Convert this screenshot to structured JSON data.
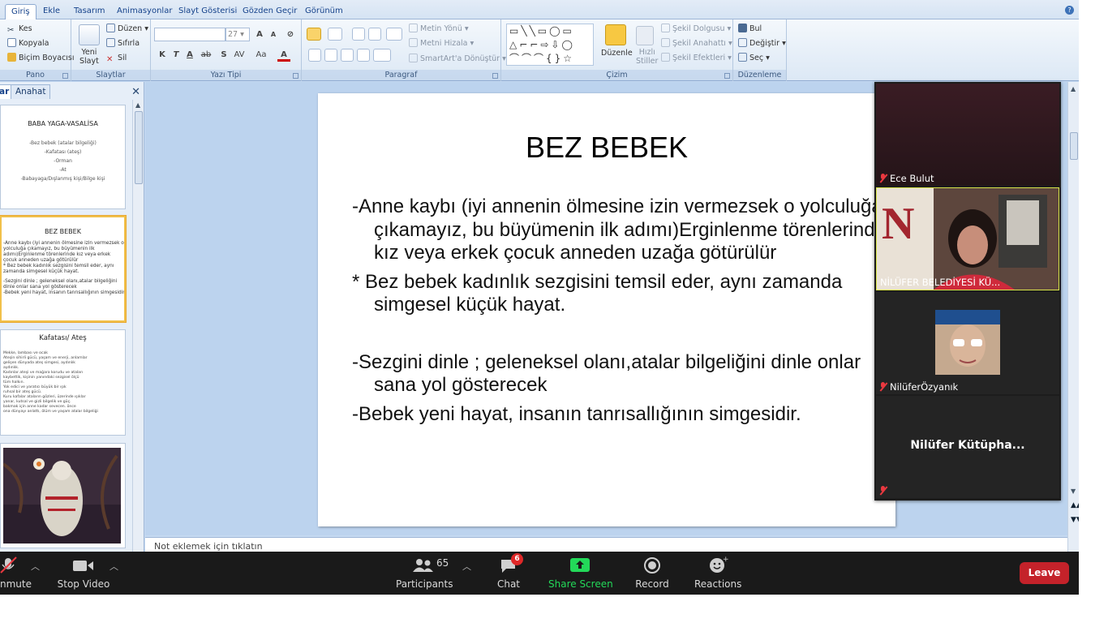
{
  "ribbon_tabs": [
    "Giriş",
    "Ekle",
    "Tasarım",
    "Animasyonlar",
    "Slayt Gösterisi",
    "Gözden Geçir",
    "Görünüm"
  ],
  "ribbon": {
    "pano": {
      "label": "Pano",
      "cut": "Kes",
      "copy": "Kopyala",
      "format_painter": "Biçim Boyacısı"
    },
    "slaytlar": {
      "label": "Slaytlar",
      "new_slide_1": "Yeni",
      "new_slide_2": "Slayt",
      "layout": "Düzen",
      "reset": "Sıfırla",
      "delete": "Sil"
    },
    "yazi_tipi": {
      "label": "Yazı Tipi",
      "font_size": "27"
    },
    "paragraf": {
      "label": "Paragraf",
      "text_direction": "Metin Yönü",
      "align_text": "Metni Hizala",
      "smartart": "SmartArt'a Dönüştür"
    },
    "cizim": {
      "label": "Çizim",
      "arrange": "Düzenle",
      "quick_styles_1": "Hızlı",
      "quick_styles_2": "Stiller",
      "shape_fill": "Şekil Dolgusu",
      "shape_outline": "Şekil Anahattı",
      "shape_effects": "Şekil Efektleri"
    },
    "duzenleme": {
      "label": "Düzenleme",
      "find": "Bul",
      "replace": "Değiştir",
      "select": "Seç"
    }
  },
  "panel_tabs": {
    "slides": "ar",
    "outline": "Anahat"
  },
  "thumbnails": [
    {
      "title": "BABA YAGA-VASALİSA",
      "lines": [
        "-Bez bebek (atalar bilgeliği)",
        "-Kafatası (ateş)",
        "-Orman",
        "-At",
        "-Babayaga/Dışlanmış kişi/Bilge kişi"
      ]
    },
    {
      "title": "BEZ BEBEK",
      "lines": [
        "-Anne kaybı (iyi annenin ölmesine izin vermezsek o",
        "  yolculuğa çıkamayız, bu büyümenin ilk",
        "  adımı)Erginlenme törenlerinde kız veya erkek",
        "  çocuk anneden uzağa götürülür",
        "* Bez bebek kadınlık sezgisini temsil eder, aynı",
        "  zamanda simgesel küçük hayat.",
        "",
        "-Sezgini dinle ; geleneksel olanı,atalar bilgeliğini",
        "  dinle onlar sana yol gösterecek",
        "-Bebek yeni hayat, insanın tanrısallığının simgesidir."
      ]
    },
    {
      "title": "Kafatası/ Ateş",
      "lines": [
        "Mekke, lambası ve ocak",
        "Ateşin sihirli gücü, yaşam ve enerji, anlamlar",
        "gelişen dünyada ateş simgesi, aydınlık",
        "aydınlık.",
        "Kadınlar ateşi ve mağara korudu ve ataları",
        "kaybettik, kişinin yanındaki sezgisel ölçü",
        "tüm halkın.",
        "Yok edici ve yaratıcı büyük bir ışık",
        "ruhsal bir ateş gücü.",
        "Kuru kafalar ataların gözleri, üzerinde ışıklar",
        "yanar, kutsal ve gizli bilgelik ve güç.",
        "bakmak için anne kadar sevecen. önce",
        "ona dünyayı anlattı, ölüm ve yaşam atalar bilgeliği"
      ]
    },
    {
      "title": "",
      "lines": []
    }
  ],
  "slide": {
    "title": "BEZ BEBEK",
    "paragraphs": [
      "-Anne kaybı (iyi annenin ölmesine izin vermezsek o yolculuğa çıkamayız, bu büyümenin ilk adımı)Erginlenme törenlerinde kız veya erkek çocuk anneden uzağa götürülür",
      "* Bez bebek kadınlık sezgisini temsil eder, aynı zamanda simgesel küçük hayat.",
      "-Sezgini dinle ; geleneksel olanı,atalar bilgeliğini dinle onlar sana yol gösterecek",
      "-Bebek yeni hayat, insanın tanrısallığının simgesidir."
    ]
  },
  "notes_placeholder": "Not eklemek için tıklatın",
  "participants": [
    {
      "name": "Ece Bulut",
      "muted": true
    },
    {
      "name": "NİLÜFER BELEDİYESİ KÜ...",
      "muted": false,
      "active_speaker": true
    },
    {
      "name": "NilüferÖzyanık",
      "muted": true
    },
    {
      "name": "Nilüfer  Kütüpha...",
      "muted": true
    }
  ],
  "zoom_toolbar": {
    "unmute": "nmute",
    "stop_video": "Stop Video",
    "participants_count": "65",
    "participants": "Participants",
    "chat": "Chat",
    "chat_badge": "6",
    "share_screen": "Share Screen",
    "record": "Record",
    "reactions": "Reactions",
    "leave": "Leave"
  },
  "colors": {
    "accent_green": "#23d959",
    "leave_red": "#c4222a",
    "selection_gold": "#f1c04a",
    "ribbon_blue": "#15428b"
  }
}
